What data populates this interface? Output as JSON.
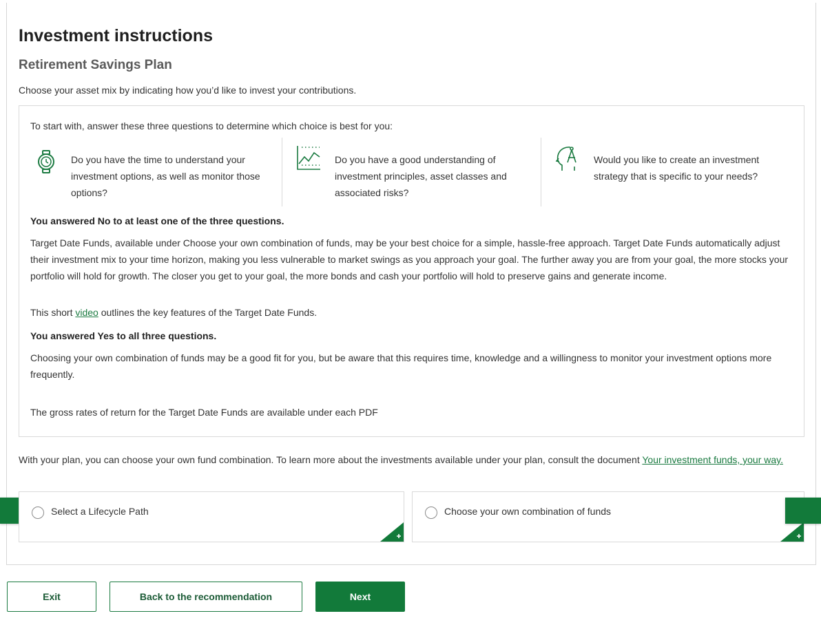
{
  "page": {
    "title": "Investment instructions",
    "subtitle": "Retirement Savings Plan",
    "intro": "Choose your asset mix by indicating how you’d like to invest your contributions."
  },
  "questions": {
    "lead": "To start with, answer these three questions to determine which choice is best for you:",
    "items": [
      {
        "icon": "stopwatch-icon",
        "text": "Do you have the time to understand your investment options, as well as monitor those options?"
      },
      {
        "icon": "line-chart-icon",
        "text": "Do you have a good understanding of investment principles, asset classes and associated risks?"
      },
      {
        "icon": "head-compass-icon",
        "text": "Would you like to create an investment strategy that is specific to your needs?"
      }
    ]
  },
  "answers": {
    "no_heading": "You answered No to at least one of the three questions.",
    "no_text": "Target Date Funds, available under Choose your own combination of funds, may be your best choice for a simple, hassle-free approach. Target Date Funds automatically adjust their investment mix to your time horizon, making you less vulnerable to market swings as you approach your goal. The further away you are from your goal, the more stocks your portfolio will hold for growth. The closer you get to your goal, the more bonds and cash your portfolio will hold to preserve gains and generate income.",
    "video_before": "This short ",
    "video_link": "video",
    "video_after": " outlines the key features of the Target Date Funds.",
    "yes_heading": "You answered Yes to all three questions.",
    "yes_text": "Choosing your own combination of funds may be a good fit for you, but be aware that this requires time, knowledge and a willingness to monitor your investment options more frequently.",
    "gross_text": "The gross rates of return for the Target Date Funds are available under each PDF"
  },
  "plan": {
    "text": "With your plan, you can choose your own fund combination. To learn more about the investments available under your plan, consult the document ",
    "link": "Your investment funds, your way."
  },
  "options": [
    {
      "label": "Select a Lifecycle Path",
      "selected": false
    },
    {
      "label": "Choose your own combination of funds",
      "selected": false
    }
  ],
  "buttons": {
    "exit": "Exit",
    "back": "Back to the recommendation",
    "next": "Next"
  },
  "colors": {
    "accent": "#127a3a",
    "link": "#1a7a40",
    "border": "#d9d9d9"
  }
}
